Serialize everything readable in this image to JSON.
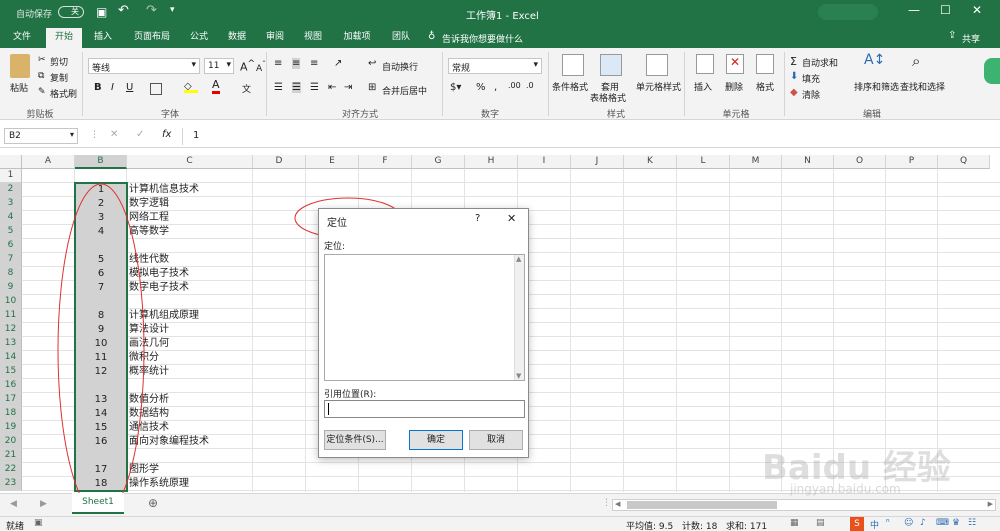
{
  "title_bar": {
    "autosave_label": "自动保存",
    "autosave_state": "关",
    "doc_title": "工作簿1 - Excel"
  },
  "tabs": [
    "文件",
    "开始",
    "插入",
    "页面布局",
    "公式",
    "数据",
    "审阅",
    "视图",
    "加载项",
    "团队"
  ],
  "tell_me": "告诉我你想要做什么",
  "share": "共享",
  "clipboard": {
    "paste": "粘贴",
    "cut": "剪切",
    "copy": "复制",
    "format_painter": "格式刷",
    "group": "剪贴板"
  },
  "font": {
    "name": "等线",
    "size": "11",
    "bold": "B",
    "italic": "I",
    "underline": "U",
    "group": "字体"
  },
  "alignment": {
    "wrap": "自动换行",
    "merge": "合并后居中",
    "group": "对齐方式"
  },
  "number": {
    "format": "常规",
    "group": "数字"
  },
  "styles": {
    "conditional": "条件格式",
    "table_format_1": "套用",
    "table_format_2": "表格格式",
    "cell_styles": "单元格样式",
    "group": "样式"
  },
  "cells": {
    "insert": "插入",
    "delete": "删除",
    "format": "格式",
    "group": "单元格"
  },
  "editing": {
    "autosum": "自动求和",
    "fill": "填充",
    "clear": "清除",
    "sort_filter": "排序和筛选",
    "find_select": "查找和选择",
    "group": "编辑"
  },
  "formula_bar": {
    "name_box": "B2",
    "fx": "fx",
    "value": "1"
  },
  "columns": [
    "A",
    "B",
    "C",
    "D",
    "E",
    "F",
    "G",
    "H",
    "I",
    "J",
    "K",
    "L",
    "M",
    "N",
    "O",
    "P",
    "Q"
  ],
  "rows": [
    {
      "n": "1",
      "b": "",
      "c": ""
    },
    {
      "n": "2",
      "b": "1",
      "c": "计算机信息技术"
    },
    {
      "n": "3",
      "b": "2",
      "c": "数字逻辑"
    },
    {
      "n": "4",
      "b": "3",
      "c": "网络工程"
    },
    {
      "n": "5",
      "b": "4",
      "c": "高等数学"
    },
    {
      "n": "6",
      "b": "",
      "c": ""
    },
    {
      "n": "7",
      "b": "5",
      "c": "线性代数"
    },
    {
      "n": "8",
      "b": "6",
      "c": "模拟电子技术"
    },
    {
      "n": "9",
      "b": "7",
      "c": "数字电子技术"
    },
    {
      "n": "10",
      "b": "",
      "c": ""
    },
    {
      "n": "11",
      "b": "8",
      "c": "计算机组成原理"
    },
    {
      "n": "12",
      "b": "9",
      "c": "算法设计"
    },
    {
      "n": "13",
      "b": "10",
      "c": "画法几何"
    },
    {
      "n": "14",
      "b": "11",
      "c": "微积分"
    },
    {
      "n": "15",
      "b": "12",
      "c": "概率统计"
    },
    {
      "n": "16",
      "b": "",
      "c": ""
    },
    {
      "n": "17",
      "b": "13",
      "c": "数值分析"
    },
    {
      "n": "18",
      "b": "14",
      "c": "数据结构"
    },
    {
      "n": "19",
      "b": "15",
      "c": "通信技术"
    },
    {
      "n": "20",
      "b": "16",
      "c": "面向对象编程技术"
    },
    {
      "n": "21",
      "b": "",
      "c": ""
    },
    {
      "n": "22",
      "b": "17",
      "c": "图形学"
    },
    {
      "n": "23",
      "b": "18",
      "c": "操作系统原理"
    }
  ],
  "sheet_tab": "Sheet1",
  "dialog": {
    "title": "定位",
    "help": "?",
    "close": "✕",
    "goto_label": "定位:",
    "ref_label": "引用位置(R):",
    "special_btn": "定位条件(S)...",
    "ok_btn": "确定",
    "cancel_btn": "取消"
  },
  "status": {
    "ready": "就绪",
    "average": "平均值: 9.5",
    "count": "计数: 18",
    "sum": "求和: 171"
  },
  "colors": {
    "excel_green": "#217346",
    "selection": "#d2d2d2",
    "annotation": "#e03030"
  }
}
